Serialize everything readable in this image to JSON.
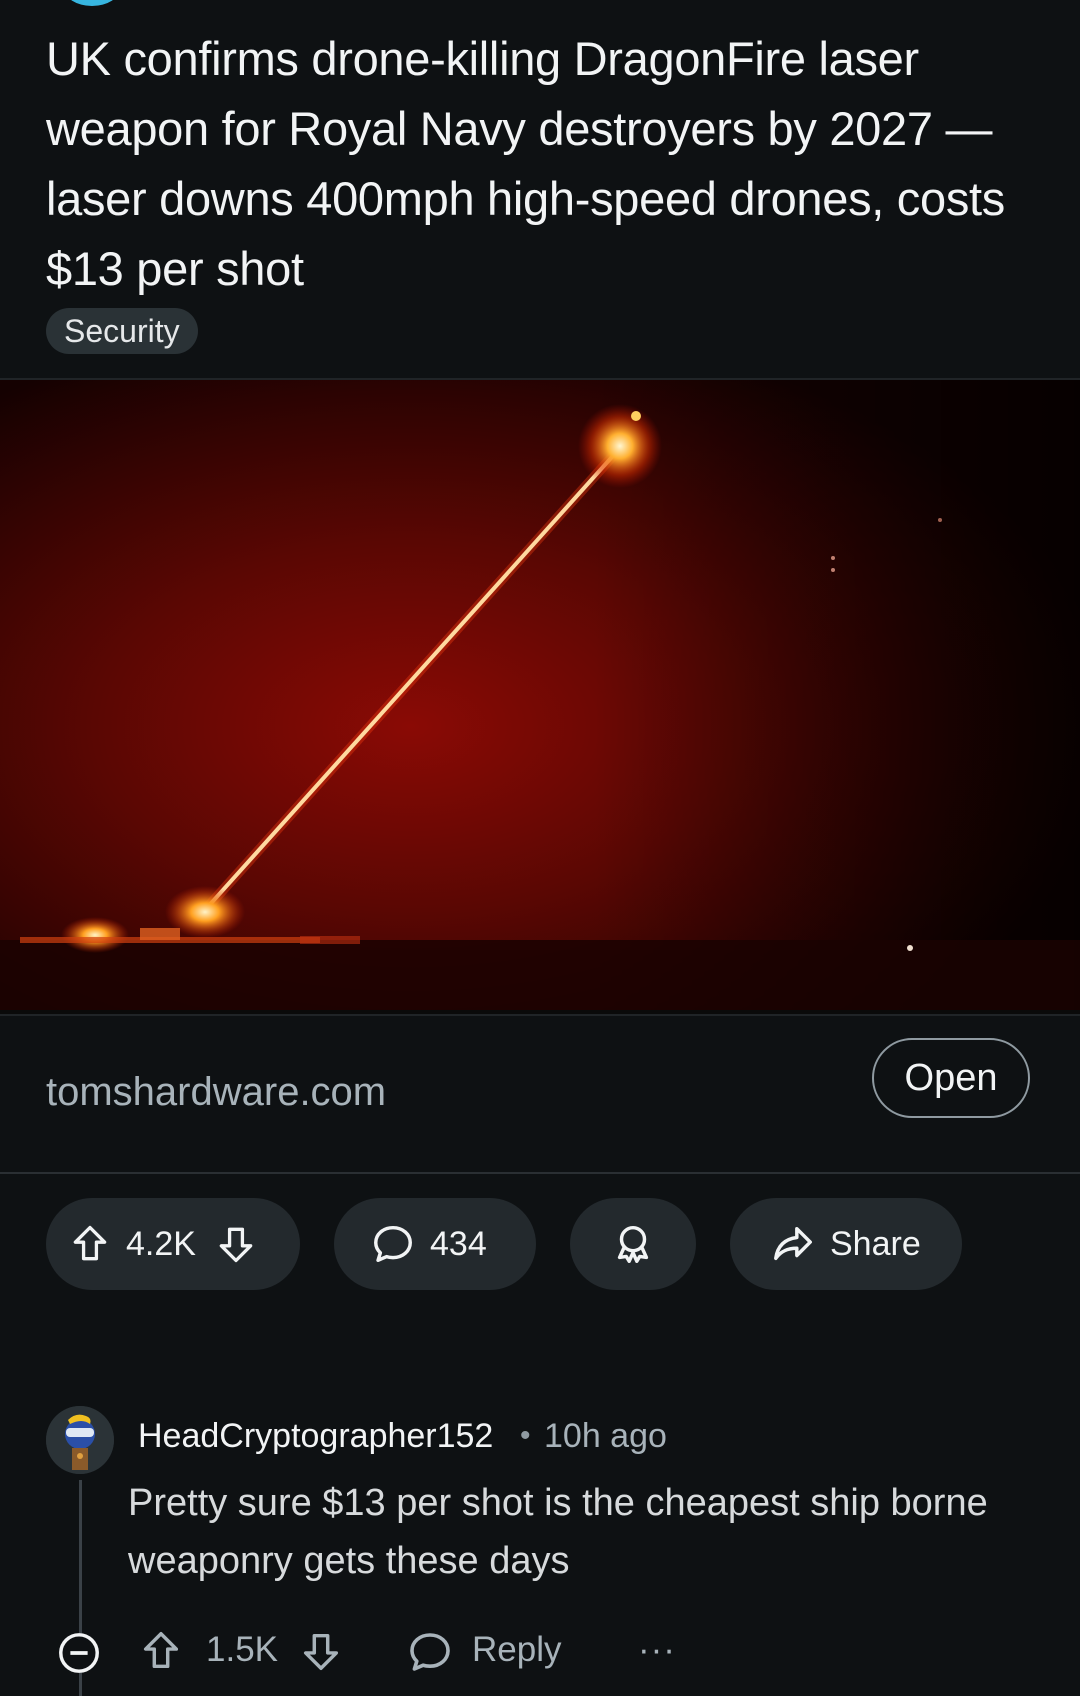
{
  "post": {
    "title": "UK confirms drone-killing DragonFire laser weapon for Royal Navy destroyers by 2027 —laser downs 400mph high-speed drones, costs $13 per shot",
    "flair": "Security",
    "media": {
      "icon": "laser-photo"
    },
    "link": {
      "domain": "tomshardware.com",
      "open_label": "Open"
    },
    "actions": {
      "upvote_icon": "arrow-up-icon",
      "score": "4.2K",
      "downvote_icon": "arrow-down-icon",
      "comment_icon": "speech-bubble-icon",
      "comments": "434",
      "award_icon": "award-icon",
      "share_icon": "share-arrow-icon",
      "share_label": "Share"
    }
  },
  "comment": {
    "author": "HeadCryptographer152",
    "separator": "•",
    "time": "10h ago",
    "body": "Pretty sure $13 per shot is the cheapest ship borne weaponry gets these days",
    "score": "1.5K",
    "reply_label": "Reply",
    "more_label": "···"
  },
  "colors": {
    "background": "#0e1113",
    "pill": "#23292d",
    "laser": "#ffd9a0",
    "muted_text": "#a8b3ba"
  }
}
